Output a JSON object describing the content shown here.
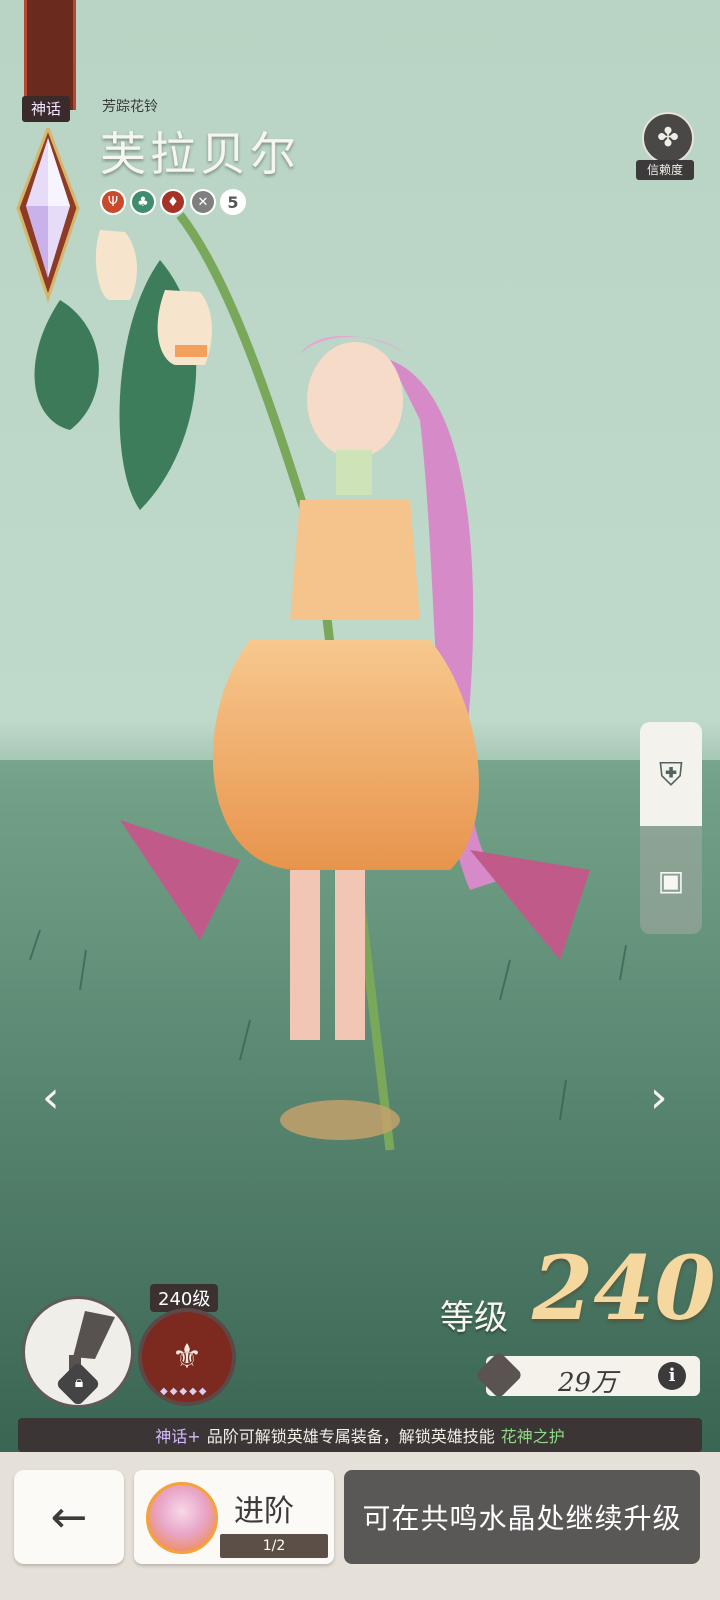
{
  "hero": {
    "rarity": "神话",
    "subtitle": "芳踪花铃",
    "name": "芙拉贝尔",
    "trait_count": "5",
    "trait_icons": [
      "trident-icon",
      "leaf-icon",
      "mask-icon",
      "crossed-swords-icon"
    ]
  },
  "trust": {
    "label": "信赖度",
    "icon": "clover-icon"
  },
  "side_tabs": {
    "tab1_icon": "helmet-icon",
    "tab2_icon": "scroll-icon"
  },
  "nav": {
    "left": "‹",
    "right": "›"
  },
  "gear": {
    "icon": "locked-equipment-icon"
  },
  "skill": {
    "level": "240级",
    "dots": "◆◆◆◆◆"
  },
  "level": {
    "label": "等级",
    "value": "240"
  },
  "power": {
    "value": "29万",
    "info": "i"
  },
  "notice": {
    "rank": "神话+",
    "text": "品阶可解锁英雄专属装备，解锁英雄技能",
    "skill": "花神之护"
  },
  "footer": {
    "back": "←",
    "advance_label": "进阶",
    "advance_count": "1/2",
    "upgrade_text": "可在共鸣水晶处继续升级"
  },
  "colors": {
    "accent_gold": "#f4d8a0",
    "skill_green": "#8fdc84",
    "rank_purple": "#d6b9ff",
    "button_dark": "#5a5757"
  }
}
